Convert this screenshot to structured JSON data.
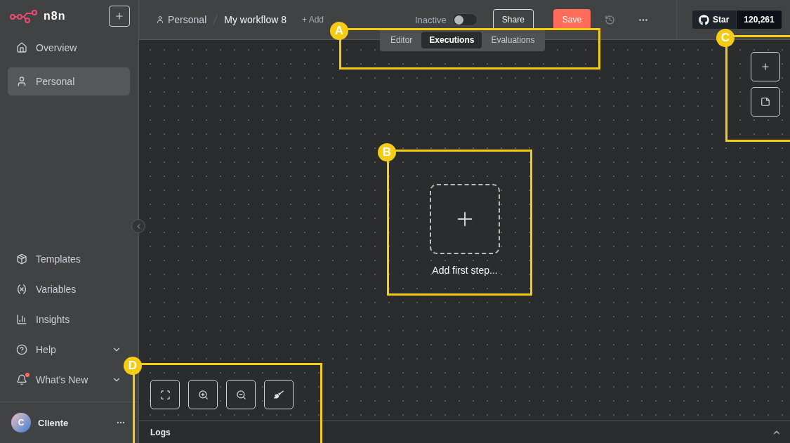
{
  "sidebar": {
    "brand": "n8n",
    "nav": [
      {
        "label": "Overview",
        "kind": "home",
        "selected": false
      },
      {
        "label": "Personal",
        "kind": "user",
        "selected": true
      }
    ],
    "bottom_nav": [
      {
        "label": "Templates",
        "kind": "templates",
        "expandable": false,
        "notification": false
      },
      {
        "label": "Variables",
        "kind": "variables",
        "expandable": false,
        "notification": false
      },
      {
        "label": "Insights",
        "kind": "insights",
        "expandable": false,
        "notification": false
      },
      {
        "label": "Help",
        "kind": "help",
        "expandable": true,
        "notification": false
      },
      {
        "label": "What's New",
        "kind": "bell",
        "expandable": true,
        "notification": true
      }
    ],
    "user": {
      "initial": "C",
      "name": "Cliente"
    }
  },
  "header": {
    "breadcrumb": {
      "project": "Personal",
      "workflow": "My workflow 8"
    },
    "add_tag": "+ Add",
    "status": {
      "label": "Inactive",
      "on": false
    },
    "share": "Share",
    "save": "Save",
    "github": {
      "label": "Star",
      "count": "120,261"
    }
  },
  "tabs": [
    {
      "label": "Editor",
      "selected": false
    },
    {
      "label": "Executions",
      "selected": true
    },
    {
      "label": "Evaluations",
      "selected": false
    }
  ],
  "canvas": {
    "add_first_step": "Add first step..."
  },
  "logs": {
    "label": "Logs"
  },
  "callouts": [
    "A",
    "B",
    "C",
    "D"
  ]
}
